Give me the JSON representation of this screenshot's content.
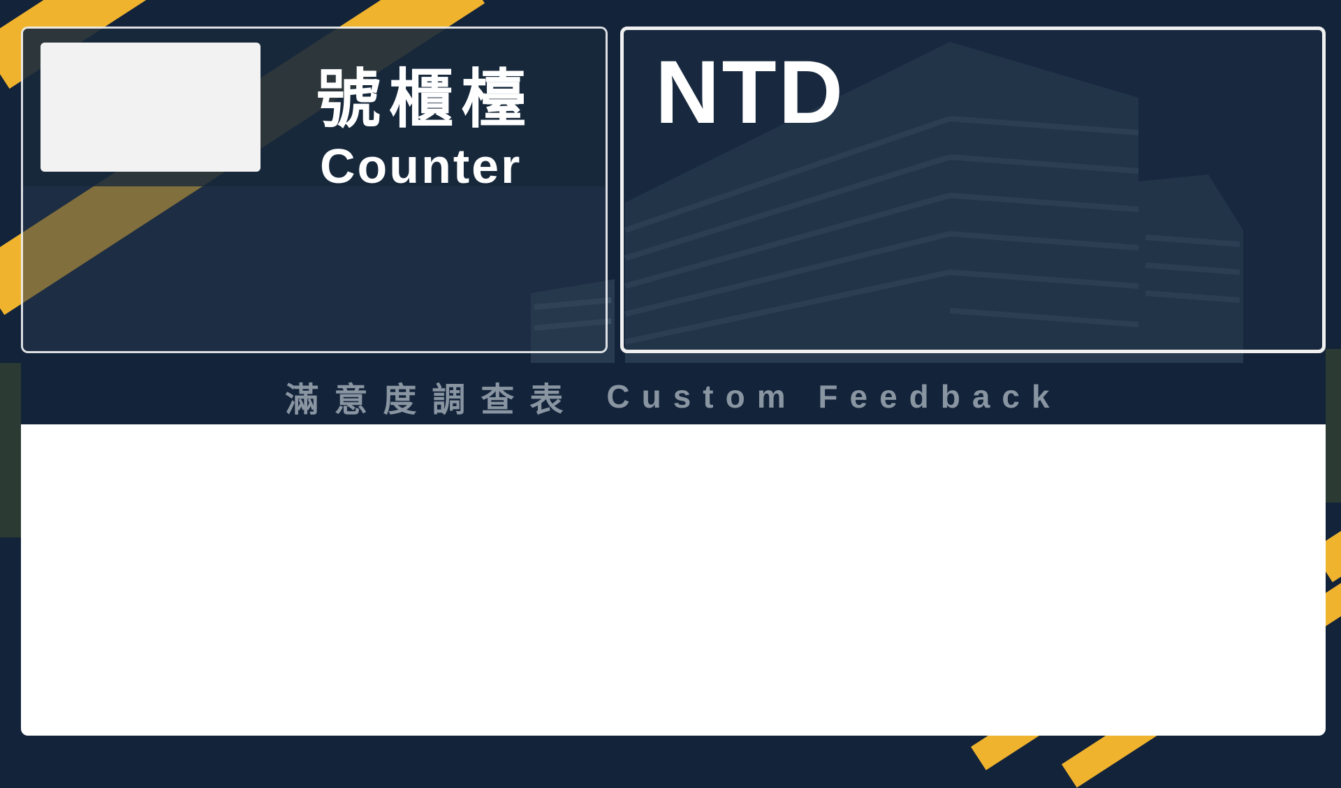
{
  "counter": {
    "title_zh": "號櫃檯",
    "title_en": "Counter",
    "number": ""
  },
  "display": {
    "value": "NTD"
  },
  "feedback": {
    "title_zh": "滿意度調查表",
    "title_en": "Custom Feedback"
  },
  "colors": {
    "accent": "#f0b32e",
    "background": "#12233a",
    "panel_header": "#12233a",
    "header_text": "#8a95a2"
  }
}
